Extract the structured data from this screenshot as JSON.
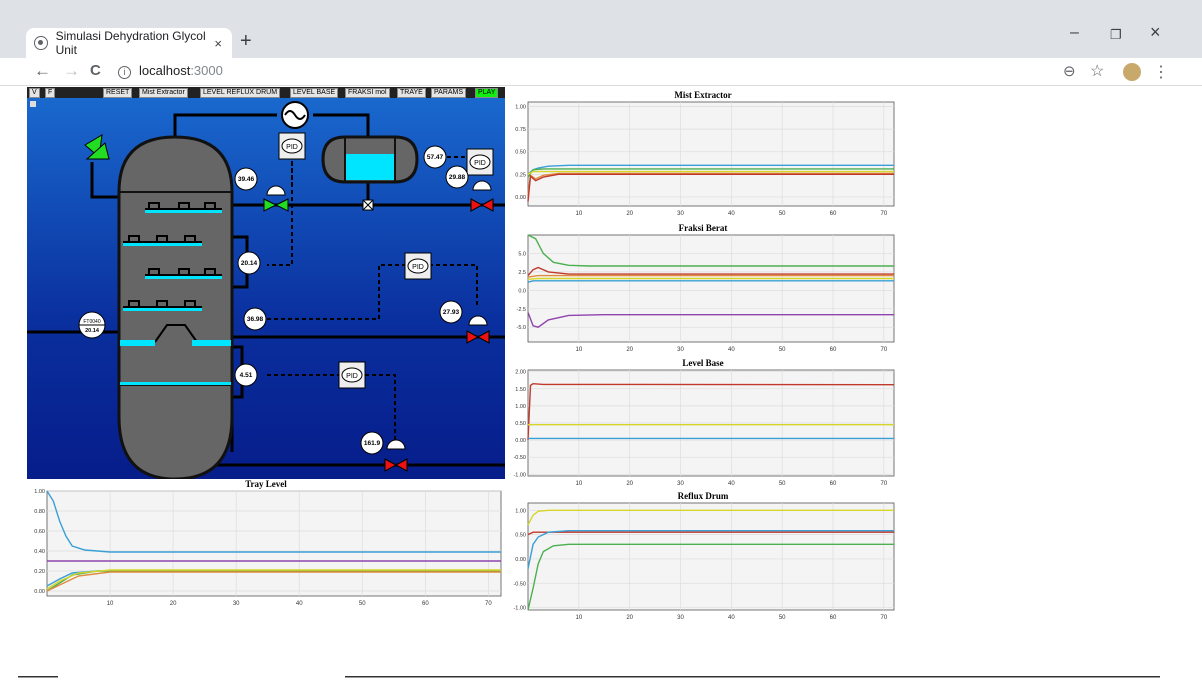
{
  "browser": {
    "tab_title": "Simulasi Dehydration Glycol Unit",
    "tab_close": "×",
    "new_tab": "+",
    "url_host": "localhost",
    "url_port": ":3000",
    "info_icon": "i",
    "nav_back": "←",
    "nav_forward": "→",
    "nav_reload": "C",
    "zoom_icon": "⊖",
    "star_icon": "☆",
    "menu_icon": "⋮",
    "win_min": "–",
    "win_max": "❐",
    "win_close": "×"
  },
  "toolbar": {
    "v": "V",
    "f": "F",
    "reset": "RESET",
    "mist": "Mist Extractor",
    "level_reflux": "LEVEL REFLUX DRUM",
    "level_base": "LEVEL BASE",
    "fraksi": "FRAKSI mol",
    "traye": "TRAYE",
    "params": "PARAMS",
    "play": "PLAY"
  },
  "plant": {
    "pid_label": "PID",
    "readings": {
      "r1": "39.46",
      "r2": "57.47",
      "r3": "29.88",
      "r4": "20.14",
      "r5": "36.98",
      "r6": "27.93",
      "r7": "4.51",
      "r8": "161.9"
    },
    "ft_tag": "FT0040",
    "ft_value": "20.14"
  },
  "colors": {
    "blue": "#3a9fd6",
    "green": "#4caf50",
    "yellow": "#d6d629",
    "red": "#c0392b",
    "orange": "#e08a3c",
    "purple": "#8e44ad",
    "cyan": "#00e5ff",
    "valve_green": "#22dd22",
    "valve_red": "#ee1111"
  },
  "chart_data": [
    {
      "id": "mist",
      "title": "Mist Extractor",
      "type": "line",
      "xticks": [
        10,
        20,
        30,
        40,
        50,
        60,
        70
      ],
      "yticks": [
        "1.00",
        "0.75",
        "0.50",
        "0.25",
        "0.00"
      ],
      "ylim": [
        -0.1,
        1.05
      ],
      "xlim": [
        0,
        72
      ],
      "series": [
        {
          "color": "blue",
          "points": [
            [
              0,
              0.25
            ],
            [
              1,
              0.3
            ],
            [
              2,
              0.32
            ],
            [
              4,
              0.34
            ],
            [
              8,
              0.35
            ],
            [
              72,
              0.35
            ]
          ]
        },
        {
          "color": "green",
          "points": [
            [
              0,
              0.22
            ],
            [
              1,
              0.3
            ],
            [
              3,
              0.31
            ],
            [
              72,
              0.31
            ]
          ]
        },
        {
          "color": "yellow",
          "points": [
            [
              0,
              0.25
            ],
            [
              1,
              0.28
            ],
            [
              3,
              0.28
            ],
            [
              72,
              0.28
            ]
          ]
        },
        {
          "color": "orange",
          "points": [
            [
              0,
              0.02
            ],
            [
              0.5,
              0.24
            ],
            [
              1.5,
              0.2
            ],
            [
              3,
              0.24
            ],
            [
              6,
              0.26
            ],
            [
              72,
              0.26
            ]
          ]
        },
        {
          "color": "red",
          "points": [
            [
              0,
              -0.05
            ],
            [
              0.5,
              0.23
            ],
            [
              1.5,
              0.18
            ],
            [
              3,
              0.22
            ],
            [
              6,
              0.25
            ],
            [
              72,
              0.25
            ]
          ]
        }
      ]
    },
    {
      "id": "fraksi",
      "title": "Fraksi Berat",
      "type": "line",
      "xticks": [
        10,
        20,
        30,
        40,
        50,
        60,
        70
      ],
      "yticks": [
        "5.0",
        "2.5",
        "0.0",
        "-2.5",
        "-5.0"
      ],
      "ylim": [
        -7,
        7.5
      ],
      "xlim": [
        0,
        72
      ],
      "series": [
        {
          "color": "green",
          "points": [
            [
              0,
              7.5
            ],
            [
              1.5,
              7
            ],
            [
              3,
              5
            ],
            [
              5,
              3.8
            ],
            [
              8,
              3.4
            ],
            [
              12,
              3.3
            ],
            [
              72,
              3.3
            ]
          ]
        },
        {
          "color": "red",
          "points": [
            [
              0,
              2
            ],
            [
              1,
              2.8
            ],
            [
              2,
              3.1
            ],
            [
              4,
              2.5
            ],
            [
              8,
              2.2
            ],
            [
              72,
              2.2
            ]
          ]
        },
        {
          "color": "orange",
          "points": [
            [
              0,
              1.8
            ],
            [
              2,
              2
            ],
            [
              72,
              2
            ]
          ]
        },
        {
          "color": "yellow",
          "points": [
            [
              0,
              1.5
            ],
            [
              2,
              1.6
            ],
            [
              72,
              1.6
            ]
          ]
        },
        {
          "color": "blue",
          "points": [
            [
              0,
              1.1
            ],
            [
              1,
              1.3
            ],
            [
              72,
              1.3
            ]
          ]
        },
        {
          "color": "purple",
          "points": [
            [
              0,
              -3
            ],
            [
              1,
              -4.8
            ],
            [
              2,
              -5
            ],
            [
              4,
              -4
            ],
            [
              8,
              -3.4
            ],
            [
              15,
              -3.3
            ],
            [
              72,
              -3.3
            ]
          ]
        }
      ]
    },
    {
      "id": "levelbase",
      "title": "Level Base",
      "type": "line",
      "xticks": [
        10,
        20,
        30,
        40,
        50,
        60,
        70
      ],
      "yticks": [
        "2.00",
        "1.50",
        "1.00",
        "0.50",
        "0.00",
        "-0.50",
        "-1.00"
      ],
      "ylim": [
        -1.05,
        2.05
      ],
      "xlim": [
        0,
        72
      ],
      "series": [
        {
          "color": "red",
          "points": [
            [
              0,
              0
            ],
            [
              0.5,
              1.6
            ],
            [
              1,
              1.65
            ],
            [
              3,
              1.63
            ],
            [
              72,
              1.62
            ]
          ]
        },
        {
          "color": "yellow",
          "points": [
            [
              0,
              0.45
            ],
            [
              72,
              0.45
            ]
          ]
        },
        {
          "color": "blue",
          "points": [
            [
              0,
              0.05
            ],
            [
              72,
              0.05
            ]
          ]
        }
      ]
    },
    {
      "id": "reflux",
      "title": "Reflux Drum",
      "type": "line",
      "xticks": [
        10,
        20,
        30,
        40,
        50,
        60,
        70
      ],
      "yticks": [
        "1.00",
        "0.50",
        "0.00",
        "-0.50",
        "-1.00"
      ],
      "ylim": [
        -1.05,
        1.15
      ],
      "xlim": [
        0,
        72
      ],
      "series": [
        {
          "color": "yellow",
          "points": [
            [
              0,
              0.7
            ],
            [
              1,
              0.9
            ],
            [
              2,
              0.98
            ],
            [
              4,
              1.0
            ],
            [
              72,
              1.0
            ]
          ]
        },
        {
          "color": "red",
          "points": [
            [
              0,
              0.5
            ],
            [
              1,
              0.55
            ],
            [
              72,
              0.55
            ]
          ]
        },
        {
          "color": "blue",
          "points": [
            [
              0,
              -0.2
            ],
            [
              1,
              0.3
            ],
            [
              2,
              0.45
            ],
            [
              4,
              0.55
            ],
            [
              8,
              0.58
            ],
            [
              72,
              0.58
            ]
          ]
        },
        {
          "color": "green",
          "points": [
            [
              0,
              -1.05
            ],
            [
              1,
              -0.6
            ],
            [
              2,
              -0.1
            ],
            [
              3,
              0.15
            ],
            [
              5,
              0.27
            ],
            [
              8,
              0.3
            ],
            [
              72,
              0.3
            ]
          ]
        }
      ]
    },
    {
      "id": "tray",
      "title": "Tray Level",
      "type": "line",
      "xticks": [
        10,
        20,
        30,
        40,
        50,
        60,
        70
      ],
      "yticks": [
        "1.00",
        "0.80",
        "0.60",
        "0.40",
        "0.20",
        "0.00"
      ],
      "ylim": [
        -0.05,
        1.0
      ],
      "xlim": [
        0,
        72
      ],
      "series": [
        {
          "color": "blue",
          "points": [
            [
              0,
              1.0
            ],
            [
              1,
              0.9
            ],
            [
              2,
              0.7
            ],
            [
              3,
              0.55
            ],
            [
              4,
              0.45
            ],
            [
              6,
              0.41
            ],
            [
              10,
              0.39
            ],
            [
              72,
              0.39
            ]
          ]
        },
        {
          "color": "purple",
          "points": [
            [
              0,
              0.3
            ],
            [
              72,
              0.3
            ]
          ]
        },
        {
          "color": "blue",
          "points": [
            [
              0,
              0.05
            ],
            [
              2,
              0.12
            ],
            [
              4,
              0.18
            ],
            [
              8,
              0.2
            ],
            [
              72,
              0.2
            ]
          ]
        },
        {
          "color": "green",
          "points": [
            [
              0,
              0.0
            ],
            [
              2,
              0.08
            ],
            [
              4,
              0.16
            ],
            [
              8,
              0.2
            ],
            [
              72,
              0.2
            ]
          ]
        },
        {
          "color": "yellow",
          "points": [
            [
              0,
              0.02
            ],
            [
              2,
              0.1
            ],
            [
              5,
              0.18
            ],
            [
              10,
              0.21
            ],
            [
              72,
              0.21
            ]
          ]
        },
        {
          "color": "orange",
          "points": [
            [
              0,
              0.0
            ],
            [
              2,
              0.06
            ],
            [
              5,
              0.15
            ],
            [
              10,
              0.19
            ],
            [
              72,
              0.19
            ]
          ]
        }
      ]
    }
  ]
}
